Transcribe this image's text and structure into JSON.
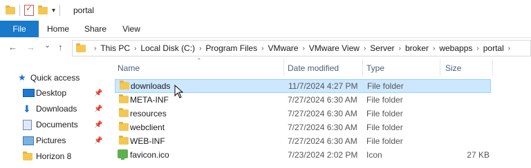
{
  "window": {
    "title": "portal"
  },
  "ribbon": {
    "tabs": [
      "File",
      "Home",
      "Share",
      "View"
    ]
  },
  "address": {
    "nav": {
      "back": "←",
      "forward": "→",
      "recent": "⌄",
      "up": "↑"
    },
    "crumbs": [
      "This PC",
      "Local Disk (C:)",
      "Program Files",
      "VMware",
      "VMware View",
      "Server",
      "broker",
      "webapps",
      "portal"
    ]
  },
  "sidebar": {
    "quick_access": "Quick access",
    "items": [
      {
        "label": "Desktop",
        "icon": "desktop-icon",
        "pinned": true
      },
      {
        "label": "Downloads",
        "icon": "downloads-icon",
        "pinned": true
      },
      {
        "label": "Documents",
        "icon": "documents-icon",
        "pinned": true
      },
      {
        "label": "Pictures",
        "icon": "pictures-icon",
        "pinned": true
      },
      {
        "label": "Horizon 8",
        "icon": "folder-icon",
        "pinned": false
      }
    ]
  },
  "columns": [
    "Name",
    "Date modified",
    "Type",
    "Size"
  ],
  "files": [
    {
      "name": "downloads",
      "date": "11/7/2024 4:27 PM",
      "type": "File folder",
      "size": "",
      "icon": "folder-icon",
      "selected": true
    },
    {
      "name": "META-INF",
      "date": "7/27/2024 6:30 AM",
      "type": "File folder",
      "size": "",
      "icon": "folder-icon",
      "selected": false
    },
    {
      "name": "resources",
      "date": "7/27/2024 6:30 AM",
      "type": "File folder",
      "size": "",
      "icon": "folder-icon",
      "selected": false
    },
    {
      "name": "webclient",
      "date": "7/27/2024 6:30 AM",
      "type": "File folder",
      "size": "",
      "icon": "folder-icon",
      "selected": false
    },
    {
      "name": "WEB-INF",
      "date": "7/27/2024 6:30 AM",
      "type": "File folder",
      "size": "",
      "icon": "folder-icon",
      "selected": false
    },
    {
      "name": "favicon.ico",
      "date": "7/23/2024 2:02 PM",
      "type": "Icon",
      "size": "27 KB",
      "icon": "favicon-icon",
      "selected": false
    }
  ],
  "colors": {
    "accent": "#1979ca",
    "selection": "#cce8ff",
    "folder": "#f3c754"
  }
}
